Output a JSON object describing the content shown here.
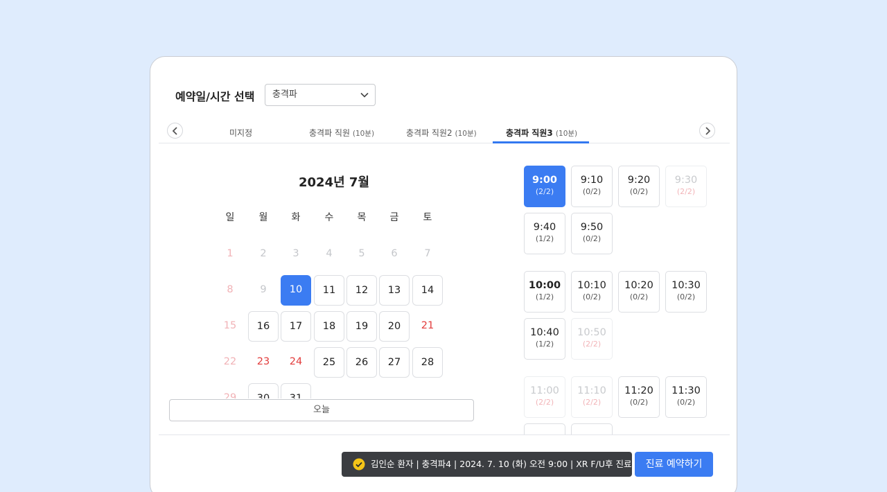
{
  "header": {
    "title": "예약일/시간 선택",
    "select_value": "충격파"
  },
  "tabs": [
    {
      "label": "미지정",
      "count": ""
    },
    {
      "label": "충격파 직원",
      "count": "(10분)"
    },
    {
      "label": "충격파 직원2",
      "count": "(10분)"
    },
    {
      "label": "충격파 직원3",
      "count": "(10분)",
      "active": true
    }
  ],
  "calendar": {
    "month_title": "2024년 7월",
    "weekdays": [
      "일",
      "월",
      "화",
      "수",
      "목",
      "금",
      "토"
    ],
    "days": [
      [
        "1",
        "sun-dis"
      ],
      [
        "2",
        "disabled"
      ],
      [
        "3",
        "disabled"
      ],
      [
        "4",
        "disabled"
      ],
      [
        "5",
        "disabled"
      ],
      [
        "6",
        "disabled"
      ],
      [
        "7",
        "disabled"
      ],
      [
        "8",
        "sun-dis"
      ],
      [
        "9",
        "disabled"
      ],
      [
        "10",
        "selected"
      ],
      [
        "11",
        "boxed"
      ],
      [
        "12",
        "boxed"
      ],
      [
        "13",
        "boxed"
      ],
      [
        "14",
        "boxed"
      ],
      [
        "15",
        "sun-dis"
      ],
      [
        "16",
        "boxed"
      ],
      [
        "17",
        "boxed"
      ],
      [
        "18",
        "boxed"
      ],
      [
        "19",
        "boxed"
      ],
      [
        "20",
        "boxed"
      ],
      [
        "21",
        "holiday"
      ],
      [
        "22",
        "sun-dis"
      ],
      [
        "23",
        "holiday"
      ],
      [
        "24",
        "holiday"
      ],
      [
        "25",
        "boxed"
      ],
      [
        "26",
        "boxed"
      ],
      [
        "27",
        "boxed"
      ],
      [
        "28",
        "boxed"
      ],
      [
        "29",
        "sun-dis"
      ],
      [
        "30",
        "boxed"
      ],
      [
        "31",
        "boxed"
      ]
    ],
    "today_label": "오늘"
  },
  "time_groups": [
    [
      {
        "time": "9:00",
        "count": "(2/2)",
        "state": "selected"
      },
      {
        "time": "9:10",
        "count": "(0/2)",
        "state": ""
      },
      {
        "time": "9:20",
        "count": "(0/2)",
        "state": ""
      },
      {
        "time": "9:30",
        "count": "(2/2)",
        "state": "full"
      },
      {
        "time": "9:40",
        "count": "(1/2)",
        "state": ""
      },
      {
        "time": "9:50",
        "count": "(0/2)",
        "state": ""
      }
    ],
    [
      {
        "time": "10:00",
        "count": "(1/2)",
        "state": "bold"
      },
      {
        "time": "10:10",
        "count": "(0/2)",
        "state": ""
      },
      {
        "time": "10:20",
        "count": "(0/2)",
        "state": ""
      },
      {
        "time": "10:30",
        "count": "(0/2)",
        "state": ""
      },
      {
        "time": "10:40",
        "count": "(1/2)",
        "state": ""
      },
      {
        "time": "10:50",
        "count": "(2/2)",
        "state": "full"
      }
    ],
    [
      {
        "time": "11:00",
        "count": "(2/2)",
        "state": "full"
      },
      {
        "time": "11:10",
        "count": "(2/2)",
        "state": "full"
      },
      {
        "time": "11:20",
        "count": "(0/2)",
        "state": ""
      },
      {
        "time": "11:30",
        "count": "(0/2)",
        "state": ""
      },
      {
        "time": "",
        "count": "",
        "state": ""
      },
      {
        "time": "",
        "count": "",
        "state": ""
      }
    ]
  ],
  "footer": {
    "summary": "김인순 환자 | 충격파4 |  2024. 7. 10 (화) 오전 9:00 | XR F/U후 진료",
    "submit_label": "진료 예약하기"
  },
  "colors": {
    "accent": "#3b7cf2",
    "holiday": "#e23b3b",
    "background": "#dfecfd"
  }
}
